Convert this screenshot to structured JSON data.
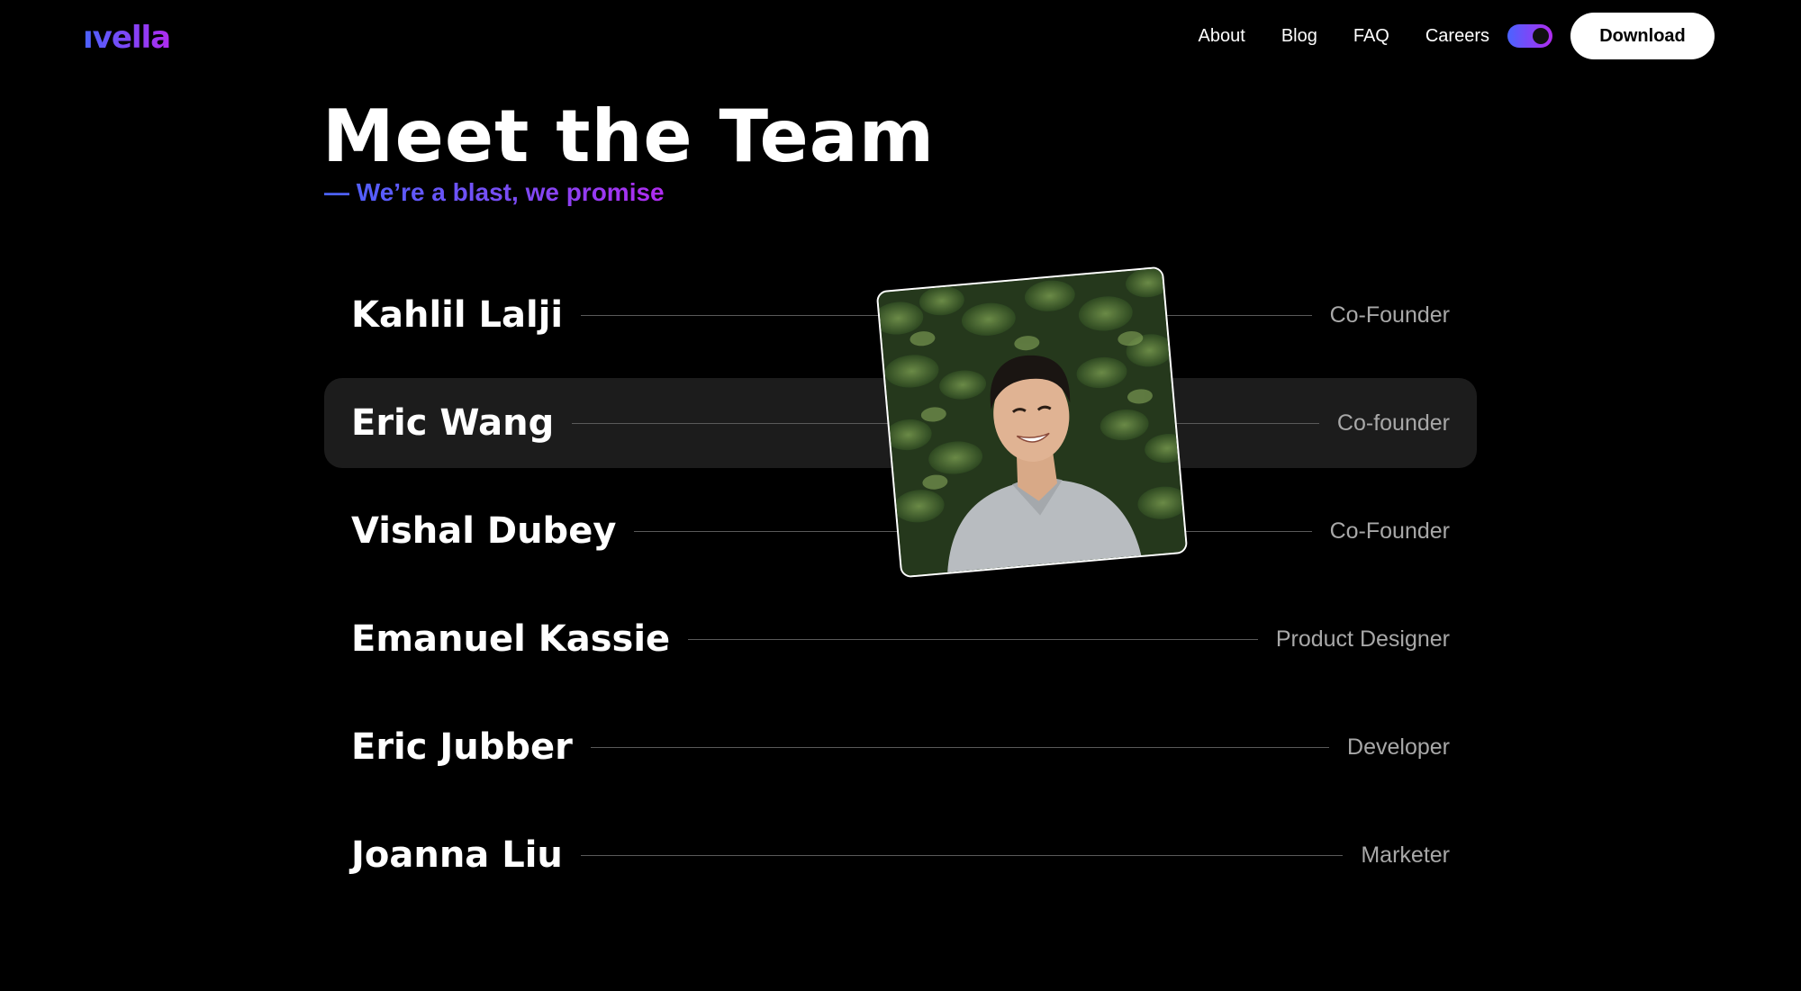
{
  "brand": {
    "logo_text": "ıvella"
  },
  "nav": {
    "links": [
      "About",
      "Blog",
      "FAQ",
      "Careers"
    ],
    "download_label": "Download",
    "theme_toggle_on": true
  },
  "hero": {
    "title": "Meet the Team",
    "subtitle": "— We’re a blast, we promise"
  },
  "team": [
    {
      "name": "Kahlil Lalji",
      "role": "Co-Founder"
    },
    {
      "name": "Eric Wang",
      "role": "Co-founder"
    },
    {
      "name": "Vishal Dubey",
      "role": "Co-Founder"
    },
    {
      "name": "Emanuel Kassie",
      "role": "Product Designer"
    },
    {
      "name": "Eric Jubber",
      "role": "Developer"
    },
    {
      "name": "Joanna Liu",
      "role": "Marketer"
    }
  ],
  "active_member_index": 1,
  "colors": {
    "gradient_start": "#4a63ff",
    "gradient_end": "#b02bf0",
    "background": "#000000",
    "active_row": "#1c1c1c"
  }
}
